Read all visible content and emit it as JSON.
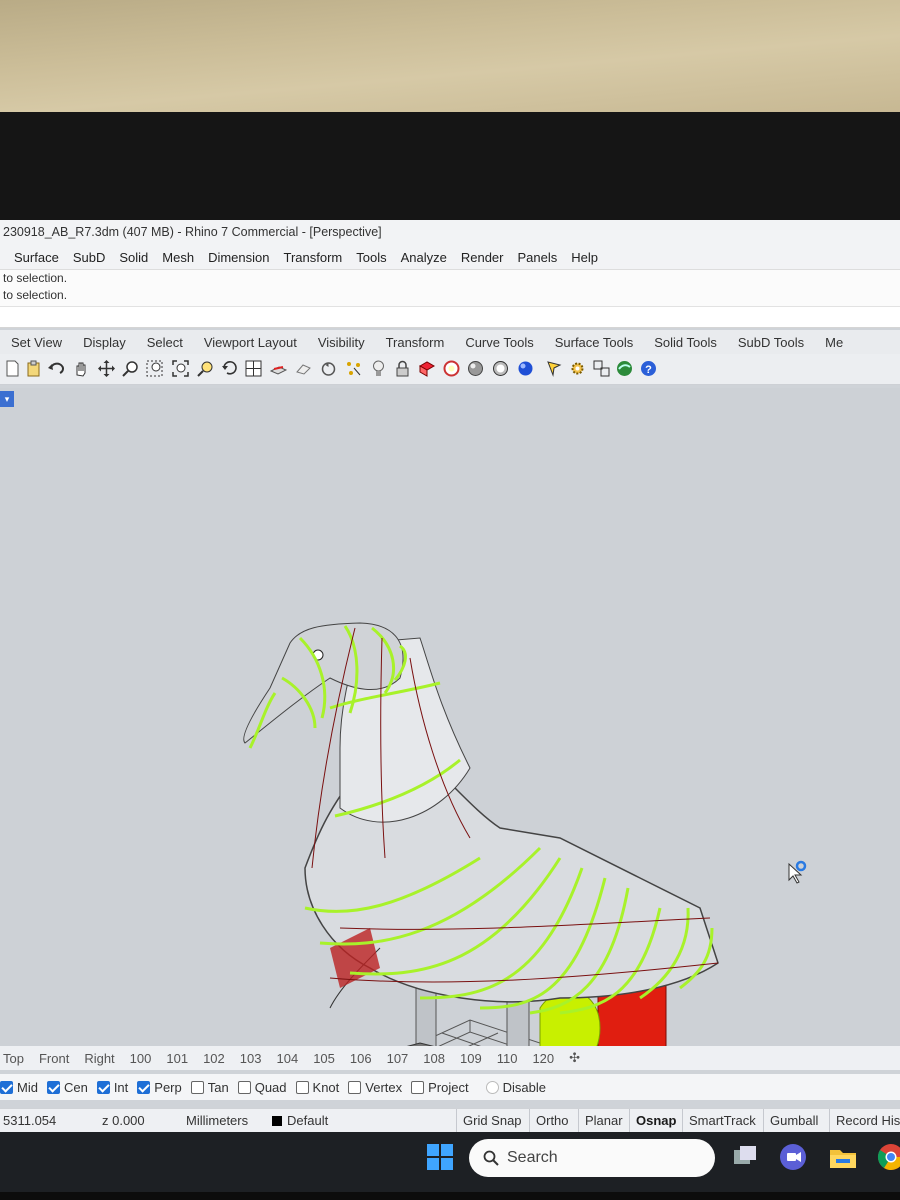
{
  "window": {
    "title": "230918_AB_R7.3dm (407 MB) - Rhino 7 Commercial - [Perspective]"
  },
  "menu": [
    "Surface",
    "SubD",
    "Solid",
    "Mesh",
    "Dimension",
    "Transform",
    "Tools",
    "Analyze",
    "Render",
    "Panels",
    "Help"
  ],
  "command_history": [
    "to selection.",
    "to selection."
  ],
  "toolbar_tabs": [
    "Set View",
    "Display",
    "Select",
    "Viewport Layout",
    "Visibility",
    "Transform",
    "Curve Tools",
    "Surface Tools",
    "Solid Tools",
    "SubD Tools",
    "Me"
  ],
  "toolbar_icons": [
    "new-icon",
    "paste-icon",
    "undo-icon",
    "pan-hand-icon",
    "move-view-icon",
    "zoom-icon",
    "zoom-window-icon",
    "zoom-extents-icon",
    "zoom-selected-icon",
    "rotate-view-icon",
    "four-viewports-icon",
    "cplane-icon",
    "named-view-icon",
    "undo-view-icon",
    "select-points-icon",
    "light-icon",
    "lock-icon",
    "properties-icon",
    "wireframe-icon",
    "shaded-icon",
    "rendered-icon",
    "sphere-icon",
    "curve-tools-icon",
    "settings-icon",
    "group-icon",
    "render-icon",
    "help-icon"
  ],
  "viewport_tabs": [
    "Top",
    "Front",
    "Right",
    "100",
    "101",
    "102",
    "103",
    "104",
    "105",
    "106",
    "107",
    "108",
    "109",
    "110",
    "120"
  ],
  "osnaps": [
    {
      "label": "Mid",
      "checked": true
    },
    {
      "label": "Cen",
      "checked": true
    },
    {
      "label": "Int",
      "checked": true
    },
    {
      "label": "Perp",
      "checked": true
    },
    {
      "label": "Tan",
      "checked": false
    },
    {
      "label": "Quad",
      "checked": false
    },
    {
      "label": "Knot",
      "checked": false
    },
    {
      "label": "Vertex",
      "checked": false
    },
    {
      "label": "Project",
      "checked": false
    },
    {
      "label": "Disable",
      "checked": false
    }
  ],
  "status": {
    "coord_x": "5311.054",
    "coord_z": "z 0.000",
    "units": "Millimeters",
    "layer": "Default",
    "buttons": [
      "Grid Snap",
      "Ortho",
      "Planar",
      "Osnap",
      "SmartTrack",
      "Gumball",
      "Record His"
    ]
  },
  "taskbar": {
    "search_placeholder": "Search"
  },
  "colors": {
    "viewport_bg": "#cdd1d6",
    "highlight_green": "#a8f22a",
    "selected_red": "#e01e10",
    "accent_blue": "#1f6fd6"
  }
}
